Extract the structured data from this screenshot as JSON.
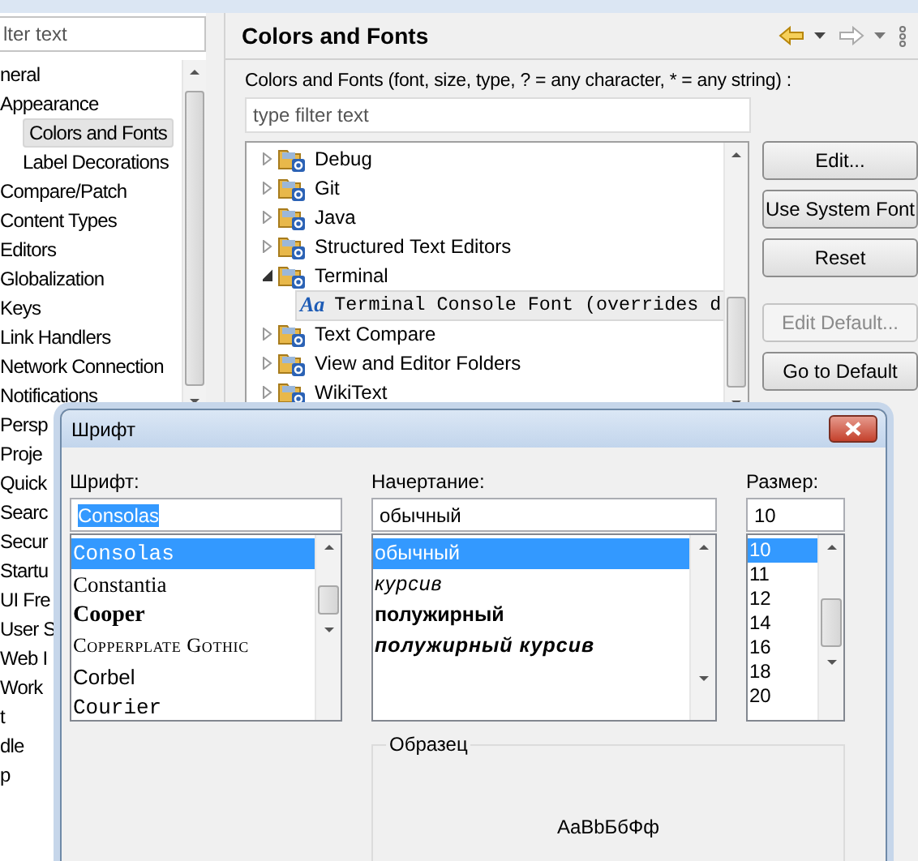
{
  "sidebar": {
    "filter": {
      "placeholder": "lter text"
    },
    "tree": [
      {
        "label": "neral",
        "selected": false,
        "children": [
          {
            "label": "Appearance",
            "selected": false,
            "children": [
              {
                "label": "Colors and Fonts",
                "selected": true
              },
              {
                "label": "Label Decorations",
                "selected": false
              }
            ]
          },
          {
            "label": "Compare/Patch",
            "selected": false
          },
          {
            "label": "Content Types",
            "selected": false
          },
          {
            "label": "Editors",
            "selected": false
          },
          {
            "label": "Globalization",
            "selected": false
          },
          {
            "label": "Keys",
            "selected": false
          },
          {
            "label": "Link Handlers",
            "selected": false
          },
          {
            "label": "Network Connection",
            "selected": false
          },
          {
            "label": "Notifications",
            "selected": false
          },
          {
            "label": "Persp",
            "selected": false
          },
          {
            "label": "Proje",
            "selected": false
          },
          {
            "label": "Quick",
            "selected": false
          },
          {
            "label": "Searc",
            "selected": false
          },
          {
            "label": "Secur",
            "selected": false
          },
          {
            "label": "Startu",
            "selected": false
          },
          {
            "label": "UI Fre",
            "selected": false
          },
          {
            "label": "User S",
            "selected": false
          },
          {
            "label": "Web I",
            "selected": false
          },
          {
            "label": "Work",
            "selected": false
          }
        ]
      },
      {
        "label": "t",
        "selected": false
      },
      {
        "label": "dle",
        "selected": false
      },
      {
        "label": "p",
        "selected": false
      }
    ]
  },
  "page": {
    "title": "Colors and Fonts",
    "description": "Colors and Fonts (font, size, type, ? = any character, * = any string) :",
    "filter": {
      "placeholder": "type filter text"
    },
    "tree": [
      {
        "kind": "category",
        "label": "Debug",
        "expanded": false,
        "selected": false
      },
      {
        "kind": "category",
        "label": "Git",
        "expanded": false,
        "selected": false
      },
      {
        "kind": "category",
        "label": "Java",
        "expanded": false,
        "selected": false
      },
      {
        "kind": "category",
        "label": "Structured Text Editors",
        "expanded": false,
        "selected": false
      },
      {
        "kind": "category",
        "label": "Terminal",
        "expanded": true,
        "selected": false,
        "children": [
          {
            "kind": "font",
            "icon_text": "Aa",
            "label": "Terminal Console Font (overrides d",
            "selected": true
          }
        ]
      },
      {
        "kind": "category",
        "label": "Text Compare",
        "expanded": false,
        "selected": false
      },
      {
        "kind": "category",
        "label": "View and Editor Folders",
        "expanded": false,
        "selected": false
      },
      {
        "kind": "category",
        "label": "WikiText",
        "expanded": false,
        "selected": false
      }
    ],
    "button_groups": [
      {
        "buttons": [
          {
            "label": "Edit...",
            "disabled": false
          },
          {
            "label": "Use System Font",
            "disabled": false
          },
          {
            "label": "Reset",
            "disabled": false
          }
        ]
      },
      {
        "buttons": [
          {
            "label": "Edit Default...",
            "disabled": true
          },
          {
            "label": "Go to Default",
            "disabled": false
          }
        ]
      }
    ]
  },
  "font_dialog": {
    "title": "Шрифт",
    "font": {
      "label": "Шрифт:",
      "value": "Consolas",
      "value_selected": true,
      "options": [
        {
          "label": "Consolas",
          "kind": "mono",
          "selected": true
        },
        {
          "label": "Constantia",
          "kind": "serif",
          "selected": false
        },
        {
          "label": "Cooper",
          "kind": "bold-serif",
          "selected": false
        },
        {
          "label": "Copperplate Gothic",
          "kind": "small-caps",
          "selected": false
        },
        {
          "label": "Corbel",
          "kind": "sans",
          "selected": false
        },
        {
          "label": "Courier",
          "kind": "mono",
          "selected": false
        }
      ]
    },
    "style": {
      "label": "Начертание:",
      "value": "обычный",
      "options": [
        {
          "label": "обычный",
          "kind": "regular",
          "selected": true
        },
        {
          "label": "курсив",
          "kind": "italic",
          "selected": false
        },
        {
          "label": "полужирный",
          "kind": "bold",
          "selected": false
        },
        {
          "label": "полужирный курсив",
          "kind": "bold-italic",
          "selected": false
        }
      ]
    },
    "size": {
      "label": "Размер:",
      "value": "10",
      "options": [
        {
          "label": "10",
          "selected": true
        },
        {
          "label": "11",
          "selected": false
        },
        {
          "label": "12",
          "selected": false
        },
        {
          "label": "14",
          "selected": false
        },
        {
          "label": "16",
          "selected": false
        },
        {
          "label": "18",
          "selected": false
        },
        {
          "label": "20",
          "selected": false
        }
      ]
    },
    "sample": {
      "label": "Образец",
      "text": "AaBbБбФф"
    }
  }
}
